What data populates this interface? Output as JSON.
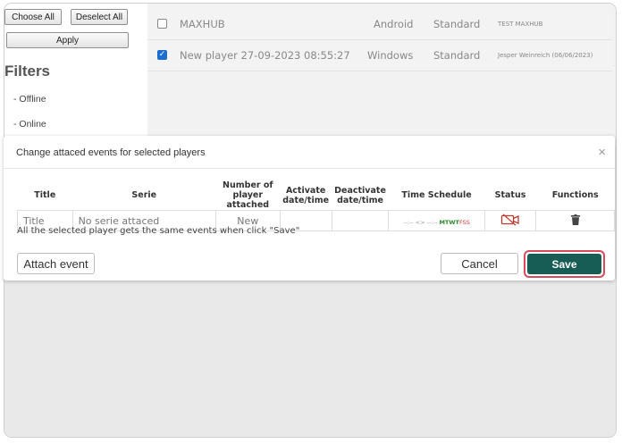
{
  "left_panel": {
    "choose_all": "Choose All",
    "deselect_all": "Deselect All",
    "apply": "Apply",
    "filters_title": "Filters",
    "filters": [
      "- Offline",
      "- Online"
    ]
  },
  "players": [
    {
      "name": "MAXHUB",
      "os": "Android",
      "type": "Standard",
      "info": "TEST MAXHUB",
      "checked": false
    },
    {
      "name": "New player 27-09-2023 08:55:27",
      "os": "Windows",
      "type": "Standard",
      "info": "Jesper Weinreich (06/06/2023)",
      "checked": true
    }
  ],
  "modal": {
    "title": "Change attaced events for selected players",
    "close_symbol": "×",
    "columns": {
      "title": "Title",
      "serie": "Serie",
      "number_line1": "Number of",
      "number_line2": "player attached",
      "activate_line1": "Activate",
      "activate_line2": "date/time",
      "deactivate_line1": "Deactivate",
      "deactivate_line2": "date/time",
      "time_schedule": "Time Schedule",
      "status": "Status",
      "functions": "Functions"
    },
    "row": {
      "title": "Title",
      "serie": "No serie attaced",
      "number": "New",
      "activate": "",
      "deactivate": "",
      "time_schedule_prefix": "--:-- <> --:--",
      "time_schedule_days_active": "MTWT",
      "time_schedule_days_rest": "FSS"
    },
    "note": "All the selected player gets the same events when click \"Save\"",
    "attach_event": "Attach event",
    "cancel": "Cancel",
    "save": "Save"
  },
  "colors": {
    "save_bg": "#175c55",
    "save_highlight": "#d94a5a",
    "status_icon": "#c0392b"
  }
}
